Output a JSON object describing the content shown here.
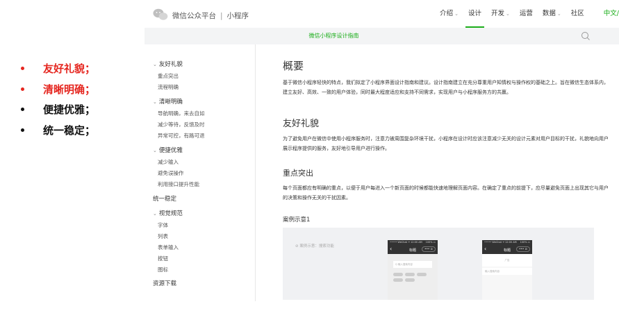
{
  "bullets": [
    {
      "text": "友好礼貌；",
      "color": "#e5261f"
    },
    {
      "text": "清晰明确；",
      "color": "#e5261f"
    },
    {
      "text": "便捷优雅；",
      "color": "#111111"
    },
    {
      "text": "统一稳定；",
      "color": "#111111"
    }
  ],
  "header": {
    "brand": "微信公众平台",
    "separator": "|",
    "product": "小程序",
    "nav": [
      {
        "label": "介绍",
        "chevron": "⌄"
      },
      {
        "label": "设计",
        "chevron": ""
      },
      {
        "label": "开发",
        "chevron": "⌄"
      },
      {
        "label": "运营",
        "chevron": ""
      },
      {
        "label": "数据",
        "chevron": "⌄"
      },
      {
        "label": "社区",
        "chevron": ""
      }
    ],
    "lang": "中文/",
    "active": "设计",
    "accent": "#1aad19"
  },
  "subbar": {
    "title": "微信小程序设计指南"
  },
  "sidebar": {
    "groups": [
      {
        "label": "友好礼貌",
        "items": [
          "重点突出",
          "流程明确"
        ]
      },
      {
        "label": "清晰明确",
        "items": [
          "导航明确，来去自如",
          "减少等待，反馈及时",
          "异常可控，有路可退"
        ]
      },
      {
        "label": "便捷优雅",
        "items": [
          "减少输入",
          "避免误操作",
          "利用接口提升性能"
        ]
      },
      {
        "label": "统一稳定",
        "items": []
      },
      {
        "label": "视觉规范",
        "items": [
          "字体",
          "列表",
          "表单输入",
          "按钮",
          "图标"
        ]
      },
      {
        "label": "资源下载",
        "items": []
      }
    ],
    "caret": "⌄"
  },
  "main": {
    "title": "概要",
    "intro": "基于微信小程序轻快的特点，我们拟定了小程序界面设计指南和建议。设计指南建立在充分尊重用户知情权与操作权的基础之上。旨在微信生态体系内，建立友好、高效、一致的用户体验，同时最大程度适应和支持不同需求，实现用户与小程序服务方的共赢。",
    "section_title": "友好礼貌",
    "section_text": "为了避免用户在微信中使用小程序服务时，注意力被周围复杂环境干扰，小程序在设计时应该注意减少无关的设计元素对用户目标的干扰，礼貌地向用户展示程序提供的服务，友好地引导用户进行操作。",
    "sub_title": "重点突出",
    "sub_text": "每个页面都应有明确的重点，以便于用户每进入一个新页面的时候都能快速地理解页面内容。在确定了重点的前提下，应尽量避免页面上出现其它与用户的决策和操作无关的干扰因素。",
    "example_title": "案例示意1",
    "example": {
      "caption": "⊘ 案例示意：搜索功能",
      "phone1": {
        "status": "••••• WeChat ᯤ",
        "time": "12:00 AM",
        "battery": "100% ▭",
        "title": "标题",
        "back": "‹",
        "caps": "••• ⊙",
        "search": "Q 输入搜索内容"
      },
      "phone2": {
        "status": "••••• WeChat ᯤ",
        "time": "12:00 AM",
        "battery": "100% ▭",
        "title": "标题",
        "back": "‹",
        "caps": "••• ⊙",
        "ad": "广告",
        "field": "输入搜索内容"
      }
    }
  }
}
